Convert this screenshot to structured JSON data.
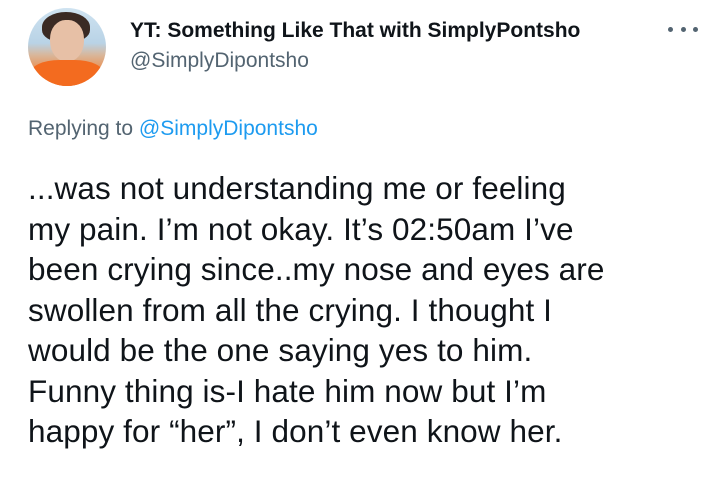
{
  "tweet": {
    "display_name": "YT: Something Like That with SimplyPontsho",
    "handle": "@SimplyDipontsho",
    "more_icon": "more-horizontal-icon",
    "avatar": "profile-photo",
    "replying_prefix": "Replying to ",
    "replying_handle": "@SimplyDipontsho",
    "body": "...was not understanding me or feeling\nmy pain. I’m not okay. It’s 02:50am I’ve\nbeen crying since..my nose and eyes are\nswollen from all the crying. I thought I\nwould be the one saying yes to him.\nFunny thing is-I hate him now but I’m\nhappy for “her”, I don’t even know her."
  },
  "colors": {
    "text": "#0f1419",
    "secondary": "#536471",
    "link": "#1d9bf0",
    "background": "#ffffff"
  }
}
